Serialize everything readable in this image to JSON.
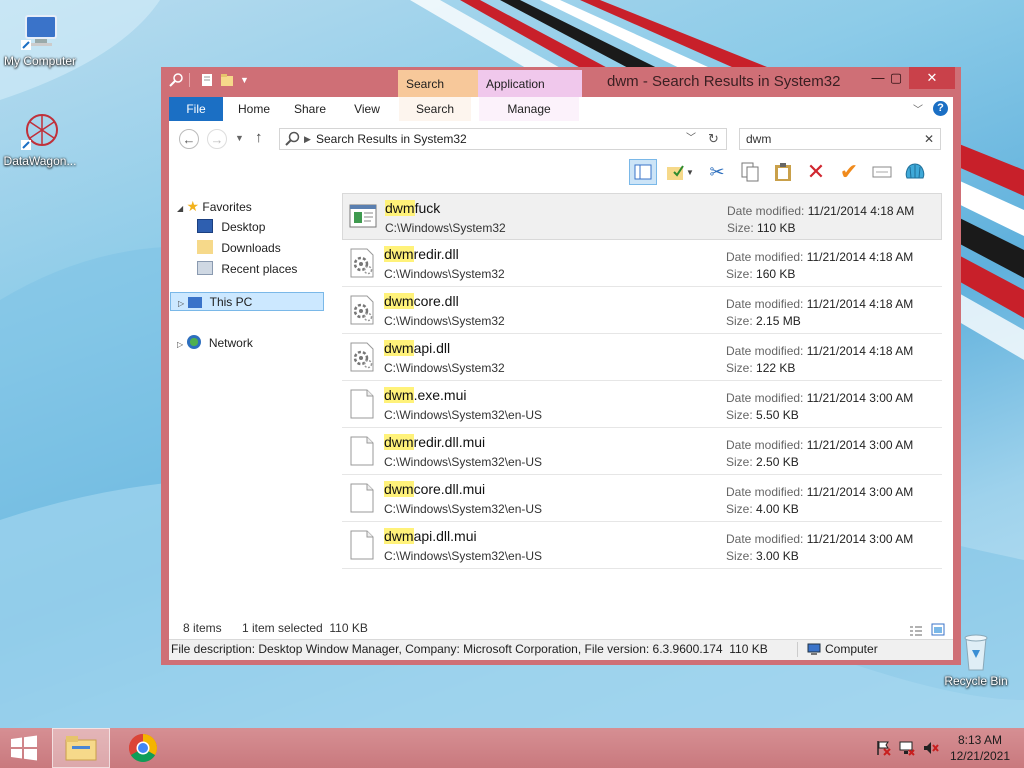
{
  "desktop": {
    "icons": [
      {
        "label": "My Computer"
      },
      {
        "label": "DataWagon..."
      },
      {
        "label": "Recycle Bin"
      }
    ]
  },
  "window": {
    "title": "dwm - Search Results in System32",
    "context_tabs": [
      {
        "label": "Search Tools",
        "color": "#f7c89a"
      },
      {
        "label": "Application Tools",
        "color": "#f0c8ec"
      }
    ],
    "ribbon_tabs": [
      "File",
      "Home",
      "Share",
      "View",
      "Search",
      "Manage"
    ],
    "address": "Search Results in System32",
    "search_value": "dwm",
    "nav": {
      "favorites": "Favorites",
      "favorites_items": [
        "Desktop",
        "Downloads",
        "Recent places"
      ],
      "this_pc": "This PC",
      "network": "Network"
    },
    "files": [
      {
        "hl": "dwm",
        "rest": "fuck",
        "path": "C:\\Windows\\System32",
        "date": "11/21/2014 4:18 AM",
        "size": "110 KB",
        "kind": "app",
        "selected": true
      },
      {
        "hl": "dwm",
        "rest": "redir.dll",
        "path": "C:\\Windows\\System32",
        "date": "11/21/2014 4:18 AM",
        "size": "160 KB",
        "kind": "dll"
      },
      {
        "hl": "dwm",
        "rest": "core.dll",
        "path": "C:\\Windows\\System32",
        "date": "11/21/2014 4:18 AM",
        "size": "2.15 MB",
        "kind": "dll"
      },
      {
        "hl": "dwm",
        "rest": "api.dll",
        "path": "C:\\Windows\\System32",
        "date": "11/21/2014 4:18 AM",
        "size": "122 KB",
        "kind": "dll"
      },
      {
        "hl": "dwm",
        "rest": ".exe.mui",
        "path": "C:\\Windows\\System32\\en-US",
        "date": "11/21/2014 3:00 AM",
        "size": "5.50 KB",
        "kind": "file"
      },
      {
        "hl": "dwm",
        "rest": "redir.dll.mui",
        "path": "C:\\Windows\\System32\\en-US",
        "date": "11/21/2014 3:00 AM",
        "size": "2.50 KB",
        "kind": "file"
      },
      {
        "hl": "dwm",
        "rest": "core.dll.mui",
        "path": "C:\\Windows\\System32\\en-US",
        "date": "11/21/2014 3:00 AM",
        "size": "4.00 KB",
        "kind": "file"
      },
      {
        "hl": "dwm",
        "rest": "api.dll.mui",
        "path": "C:\\Windows\\System32\\en-US",
        "date": "11/21/2014 3:00 AM",
        "size": "3.00 KB",
        "kind": "file"
      }
    ],
    "labels": {
      "date_modified": "Date modified:",
      "size": "Size:"
    },
    "status": {
      "items": "8 items",
      "selected": "1 item selected  110 KB"
    },
    "description": "File description: Desktop Window Manager, Company: Microsoft Corporation, File version: 6.3.9600.174  110 KB",
    "computer_label": "Computer"
  },
  "taskbar": {
    "time": "8:13 AM",
    "date": "12/21/2021"
  },
  "colors": {
    "accent": "#1b6fc4",
    "frame": "#cf6f76",
    "highlight": "#fff27a",
    "close": "#c9414a"
  }
}
